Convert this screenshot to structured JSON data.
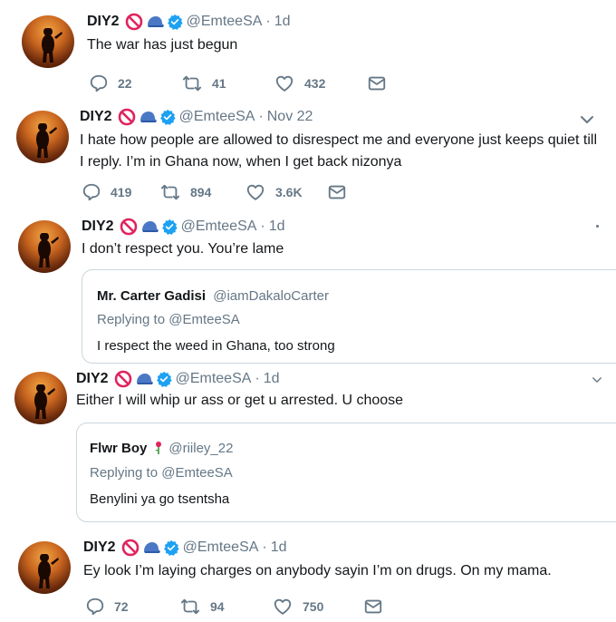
{
  "colors": {
    "accent": "#1da1f2",
    "muted": "#657786",
    "text": "#14171a",
    "verified": "#1da1f2",
    "prohibited": "#e0245e"
  },
  "tweets": [
    {
      "name": "DIY2",
      "handle": "@EmteeSA",
      "time": "1d",
      "text": "The war has just begun",
      "actions": {
        "replies": "22",
        "retweets": "41",
        "likes": "432"
      }
    },
    {
      "name": "DIY2",
      "handle": "@EmteeSA",
      "time": "Nov 22",
      "text_line1": "I hate how people are allowed to disrespect me and everyone just keeps quiet till",
      "text_line2": "I reply. I’m in Ghana now, when I get back nizonya",
      "actions": {
        "replies": "419",
        "retweets": "894",
        "likes": "3.6K"
      }
    },
    {
      "name": "DIY2",
      "handle": "@EmteeSA",
      "time": "1d",
      "text": "I don’t respect you. You’re lame",
      "quote": {
        "name": "Mr. Carter Gadisi",
        "handle": "@iamDakaloCarter",
        "replying_label": "Replying to",
        "replying_handle": "@EmteeSA",
        "text": "I respect  the weed in Ghana, too strong"
      }
    },
    {
      "name": "DIY2",
      "handle": "@EmteeSA",
      "time": "1d",
      "text": "Either I will whip ur ass or get u arrested. U choose",
      "quote": {
        "name": "Flwr Boy",
        "handle": "@riiley_22",
        "replying_label": "Replying to",
        "replying_handle": "@EmteeSA",
        "text": "Benylini ya go tsentsha"
      }
    },
    {
      "name": "DIY2",
      "handle": "@EmteeSA",
      "time": "1d",
      "text": "Ey look I’m laying charges on anybody sayin I’m on drugs. On my mama.",
      "actions": {
        "replies": "72",
        "retweets": "94",
        "likes": "750"
      }
    }
  ]
}
